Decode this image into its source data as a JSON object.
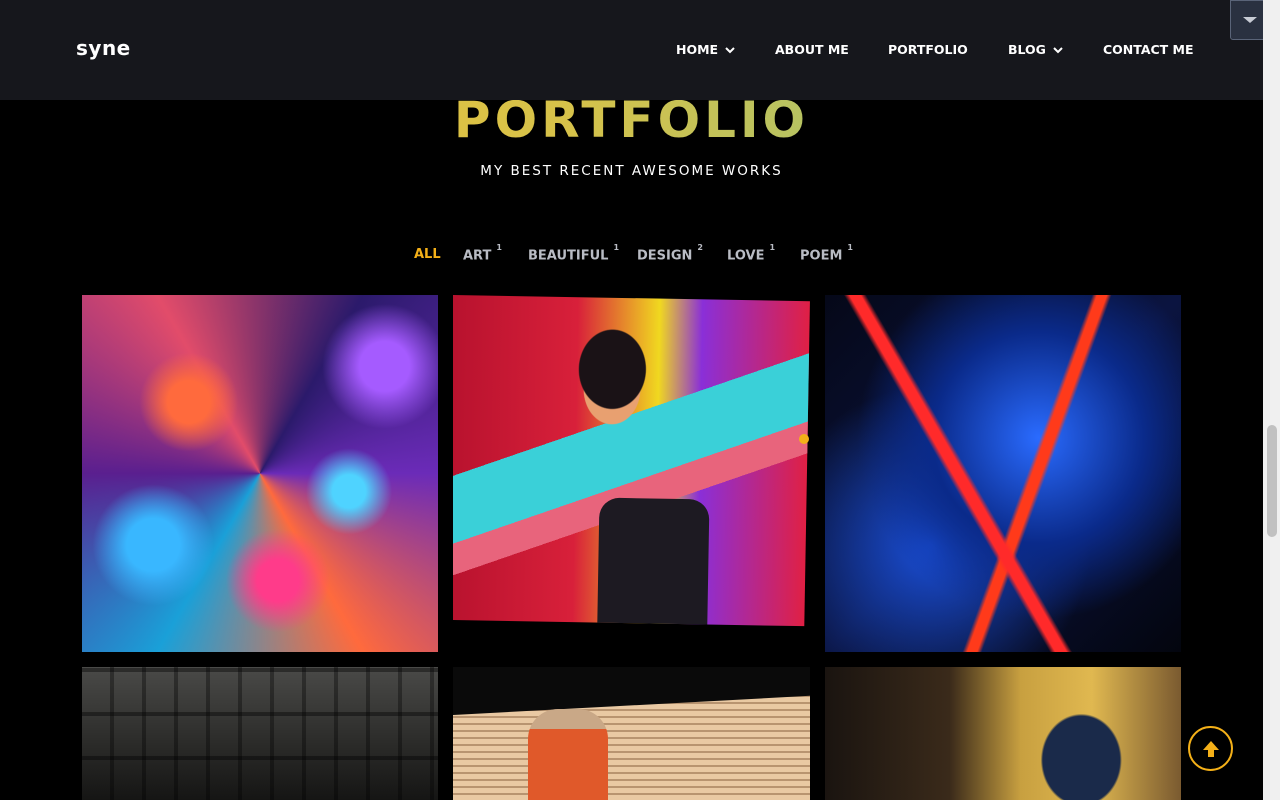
{
  "header": {
    "logo": "syne",
    "nav": [
      {
        "label": "HOME",
        "has_dropdown": true
      },
      {
        "label": "ABOUT ME",
        "has_dropdown": false
      },
      {
        "label": "PORTFOLIO",
        "has_dropdown": false
      },
      {
        "label": "BLOG",
        "has_dropdown": true
      },
      {
        "label": "CONTACT ME",
        "has_dropdown": false
      }
    ]
  },
  "section": {
    "title": "PORTFOLIO",
    "subtitle": "MY BEST RECENT AWESOME WORKS"
  },
  "filters": [
    {
      "label": "ALL",
      "count": "",
      "active": true
    },
    {
      "label": "ART",
      "count": "1",
      "active": false
    },
    {
      "label": "BEAUTIFUL",
      "count": "1",
      "active": false
    },
    {
      "label": "DESIGN",
      "count": "2",
      "active": false
    },
    {
      "label": "LOVE",
      "count": "1",
      "active": false
    },
    {
      "label": "POEM",
      "count": "1",
      "active": false
    }
  ],
  "portfolio_items": [
    {
      "image": "fractal-art"
    },
    {
      "image": "neon-portrait"
    },
    {
      "image": "abstract-blue-red"
    },
    {
      "image": "city-building"
    },
    {
      "image": "man-with-hat"
    },
    {
      "image": "street-mural"
    }
  ],
  "icons": {
    "dropdown_toggle": "chevron-down-icon",
    "scroll_to_top": "arrow-up-icon"
  },
  "colors": {
    "accent": "#f4b018",
    "header_bg": "#16171c",
    "page_bg": "#000000",
    "filter_text": "#b9bcc4",
    "title_gradient_start": "#f7c22e",
    "title_gradient_end": "#7cc48f"
  }
}
